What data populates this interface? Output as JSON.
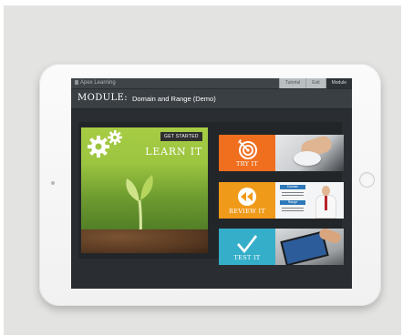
{
  "app": {
    "brand": "Apex Learning",
    "tabs": [
      {
        "label": "Tutorial",
        "active": false
      },
      {
        "label": "Exit",
        "active": false
      },
      {
        "label": "Module",
        "active": true
      }
    ]
  },
  "header": {
    "module_label": "MODULE:",
    "module_title": "Domain and Range (Demo)"
  },
  "learn": {
    "get_started": "GET STARTED",
    "title": "LEARN IT",
    "icon": "gears-icon"
  },
  "cards": [
    {
      "label": "TRY IT",
      "icon": "target-icon",
      "color": "#ef6f1f"
    },
    {
      "label": "REVIEW IT",
      "icon": "rewind-icon",
      "color": "#f09a1a"
    },
    {
      "label": "TEST IT",
      "icon": "checkmark-icon",
      "color": "#35aec9"
    }
  ],
  "review_preview": {
    "domain_tag": "Domain",
    "range_tag": "Range"
  }
}
